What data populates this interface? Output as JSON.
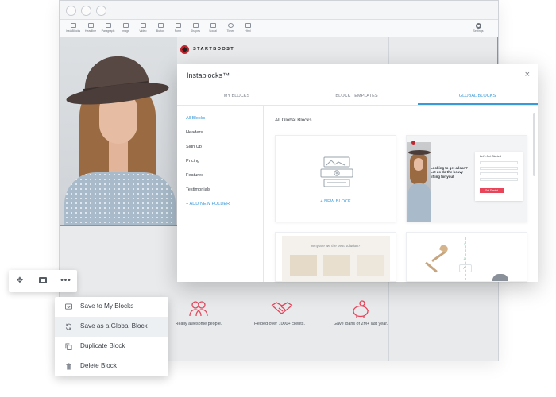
{
  "toolbar": {
    "items": [
      "InstaBlocks",
      "Headline",
      "Paragraph",
      "Image",
      "Video",
      "Button",
      "Form",
      "Shapes",
      "Social",
      "Timer",
      "Html"
    ],
    "settings": "Settings"
  },
  "page": {
    "logo": "STARTBOOST",
    "features": [
      {
        "text": "Really awesome people.",
        "icon": "people-icon"
      },
      {
        "text": "Helped over 1000+ clients.",
        "icon": "handshake-icon"
      },
      {
        "text": "Gave loans of 2M+ last year.",
        "icon": "piggy-bank-icon"
      }
    ]
  },
  "modal": {
    "title": "Instablocks™",
    "close": "×",
    "tabs": [
      "MY BLOCKS",
      "BLOCK TEMPLATES",
      "GLOBAL BLOCKS"
    ],
    "active_tab": "GLOBAL BLOCKS",
    "sidebar": [
      "All Blocks",
      "Headers",
      "Sign Up",
      "Pricing",
      "Features",
      "Testimonials"
    ],
    "add_folder": "+ ADD NEW FOLDER",
    "content_title": "All Global Blocks",
    "new_block": "+ NEW BLOCK",
    "preview_loan": {
      "heading": "Looking to get a loan? Let us do the heavy lifting for you!",
      "form_title": "Let's Get Started",
      "cta": "Get Started"
    },
    "preview_solution": {
      "heading": "Why are we the best solution?"
    }
  },
  "mini_toolbar": [
    "move-icon",
    "image-icon",
    "more-icon"
  ],
  "context_menu": [
    {
      "label": "Save to My Blocks",
      "icon": "save-icon"
    },
    {
      "label": "Save as a Global Block",
      "icon": "sync-icon"
    },
    {
      "label": "Duplicate Block",
      "icon": "duplicate-icon"
    },
    {
      "label": "Delete Block",
      "icon": "trash-icon"
    }
  ],
  "colors": {
    "accent": "#3a9ad9",
    "brand": "#c0262f",
    "danger": "#e8445a"
  }
}
